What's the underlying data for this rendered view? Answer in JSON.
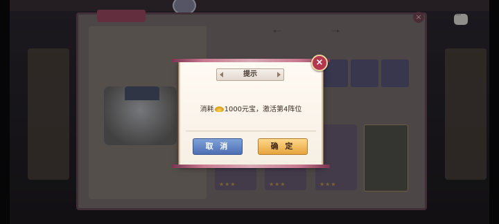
{
  "background": {
    "panel_tab_label": "",
    "left_title": "",
    "left_note": "",
    "right_title": "",
    "right_desc_lines": [
      "",
      ""
    ],
    "slots": 4,
    "stars": "★★★"
  },
  "dialog": {
    "title": "提示",
    "message_prefix": "消耗",
    "message_suffix": "1000元宝，激活第4阵位",
    "cancel_label": "取 消",
    "confirm_label": "确 定",
    "close_label": "×",
    "currency_icon": "gold-ingot-icon"
  },
  "colors": {
    "close_red": "#b3374f",
    "cancel_blue": "#5a7bbf",
    "confirm_gold": "#e9b04f"
  }
}
